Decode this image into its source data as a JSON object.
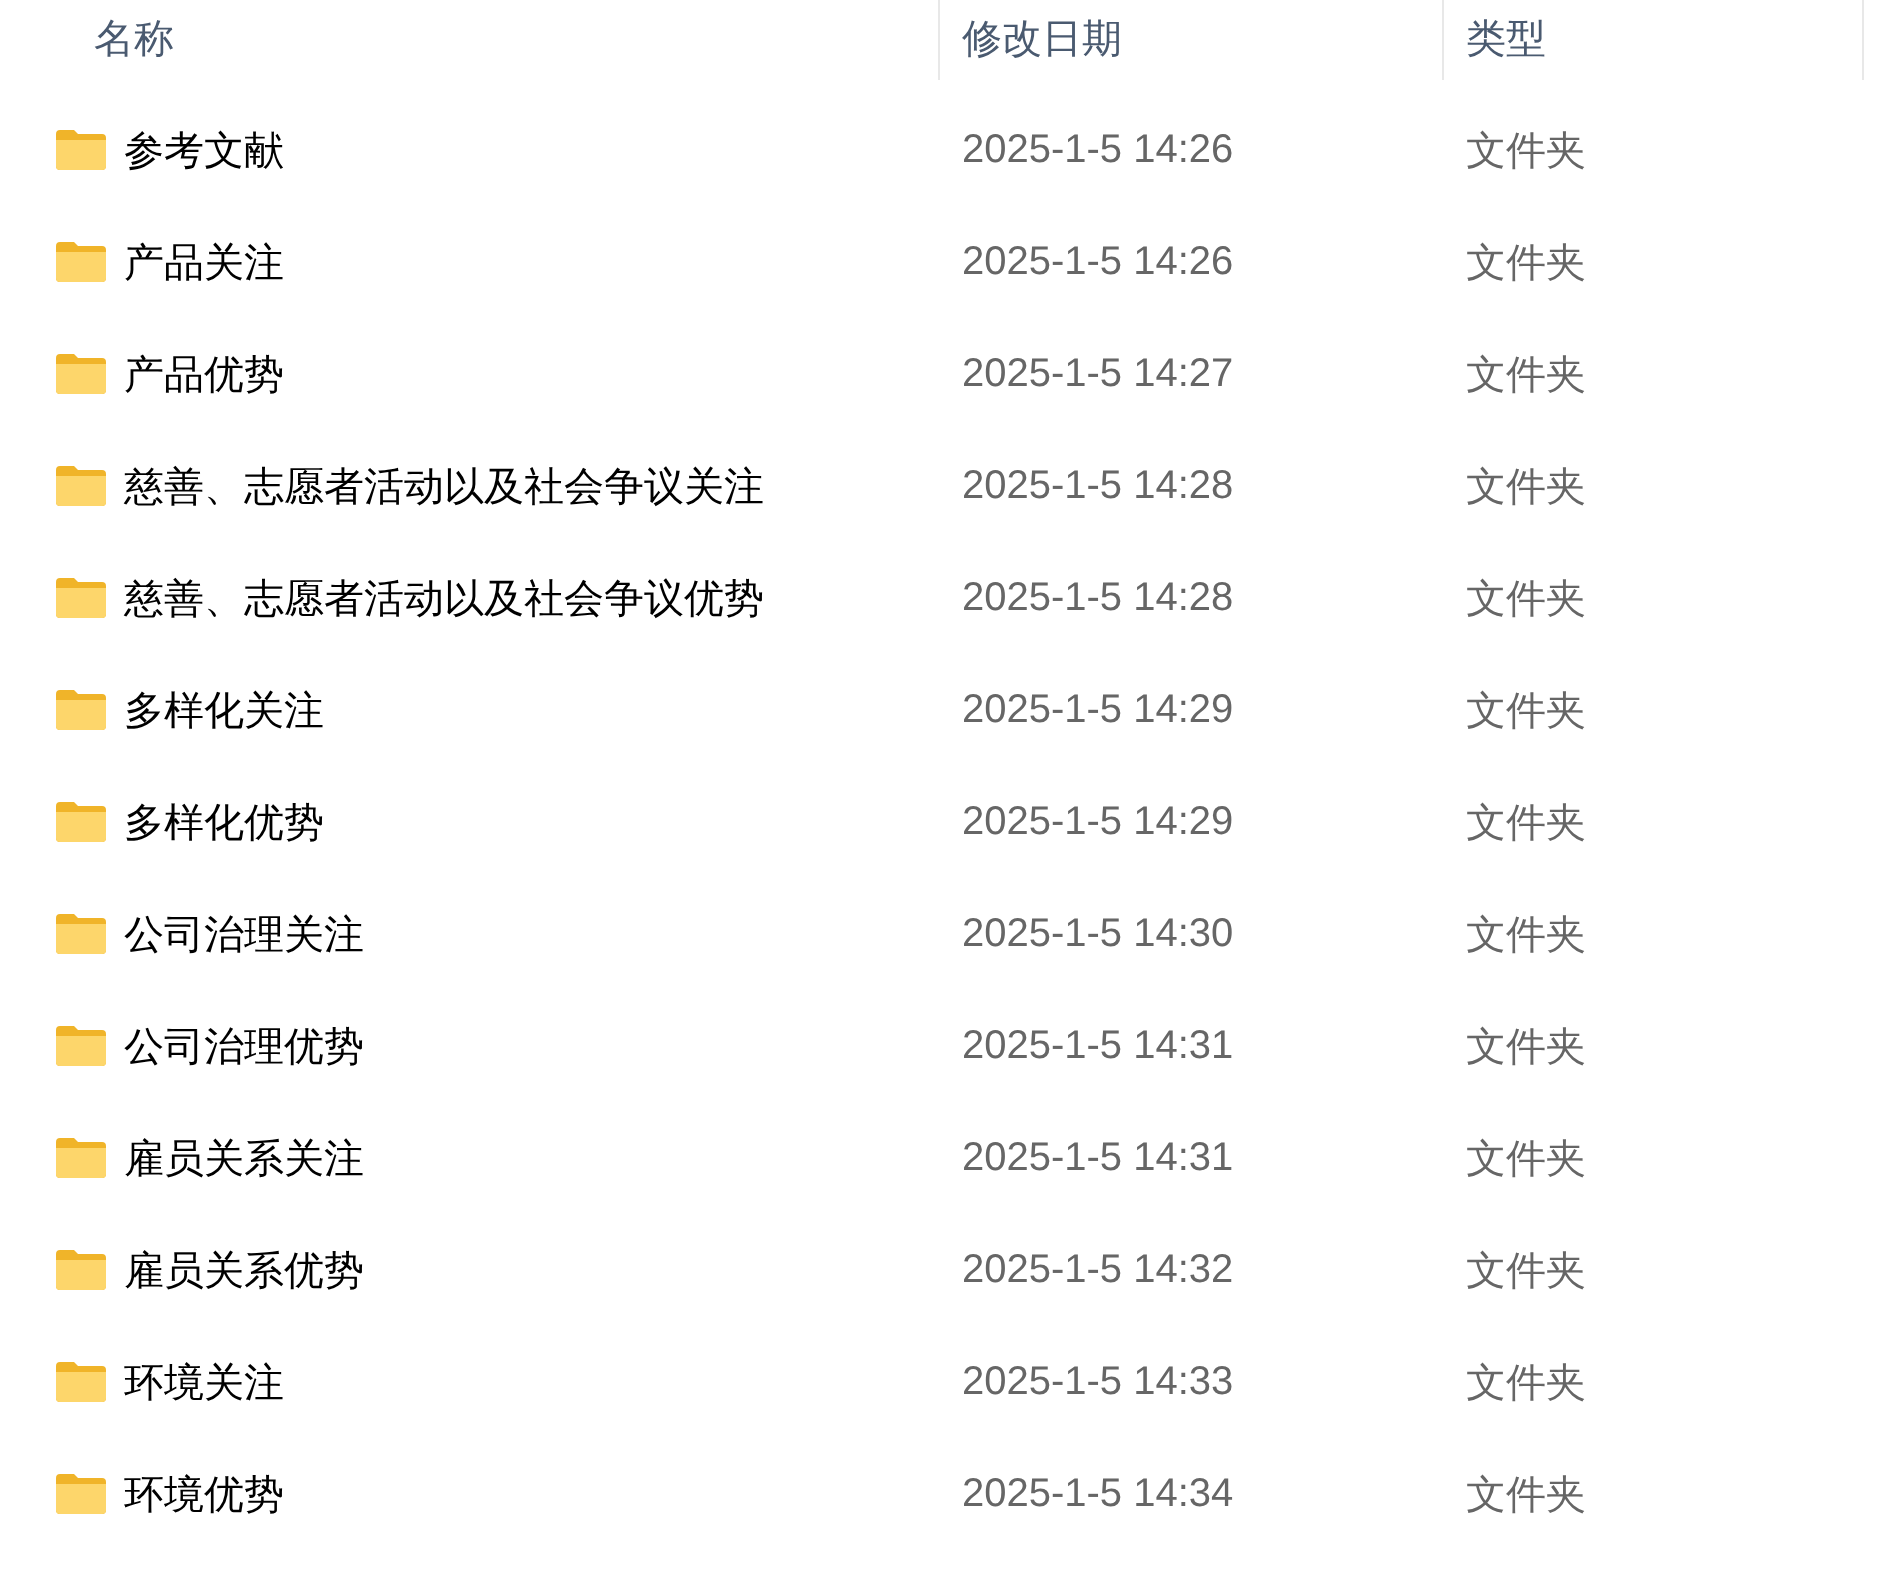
{
  "columns": [
    "名称",
    "修改日期",
    "类型"
  ],
  "rows": [
    {
      "name": "参考文献",
      "modified": "2025-1-5 14:26",
      "type": "文件夹"
    },
    {
      "name": "产品关注",
      "modified": "2025-1-5 14:26",
      "type": "文件夹"
    },
    {
      "name": "产品优势",
      "modified": "2025-1-5 14:27",
      "type": "文件夹"
    },
    {
      "name": "慈善、志愿者活动以及社会争议关注",
      "modified": "2025-1-5 14:28",
      "type": "文件夹"
    },
    {
      "name": "慈善、志愿者活动以及社会争议优势",
      "modified": "2025-1-5 14:28",
      "type": "文件夹"
    },
    {
      "name": "多样化关注",
      "modified": "2025-1-5 14:29",
      "type": "文件夹"
    },
    {
      "name": "多样化优势",
      "modified": "2025-1-5 14:29",
      "type": "文件夹"
    },
    {
      "name": "公司治理关注",
      "modified": "2025-1-5 14:30",
      "type": "文件夹"
    },
    {
      "name": "公司治理优势",
      "modified": "2025-1-5 14:31",
      "type": "文件夹"
    },
    {
      "name": "雇员关系关注",
      "modified": "2025-1-5 14:31",
      "type": "文件夹"
    },
    {
      "name": "雇员关系优势",
      "modified": "2025-1-5 14:32",
      "type": "文件夹"
    },
    {
      "name": "环境关注",
      "modified": "2025-1-5 14:33",
      "type": "文件夹"
    },
    {
      "name": "环境优势",
      "modified": "2025-1-5 14:34",
      "type": "文件夹"
    }
  ]
}
